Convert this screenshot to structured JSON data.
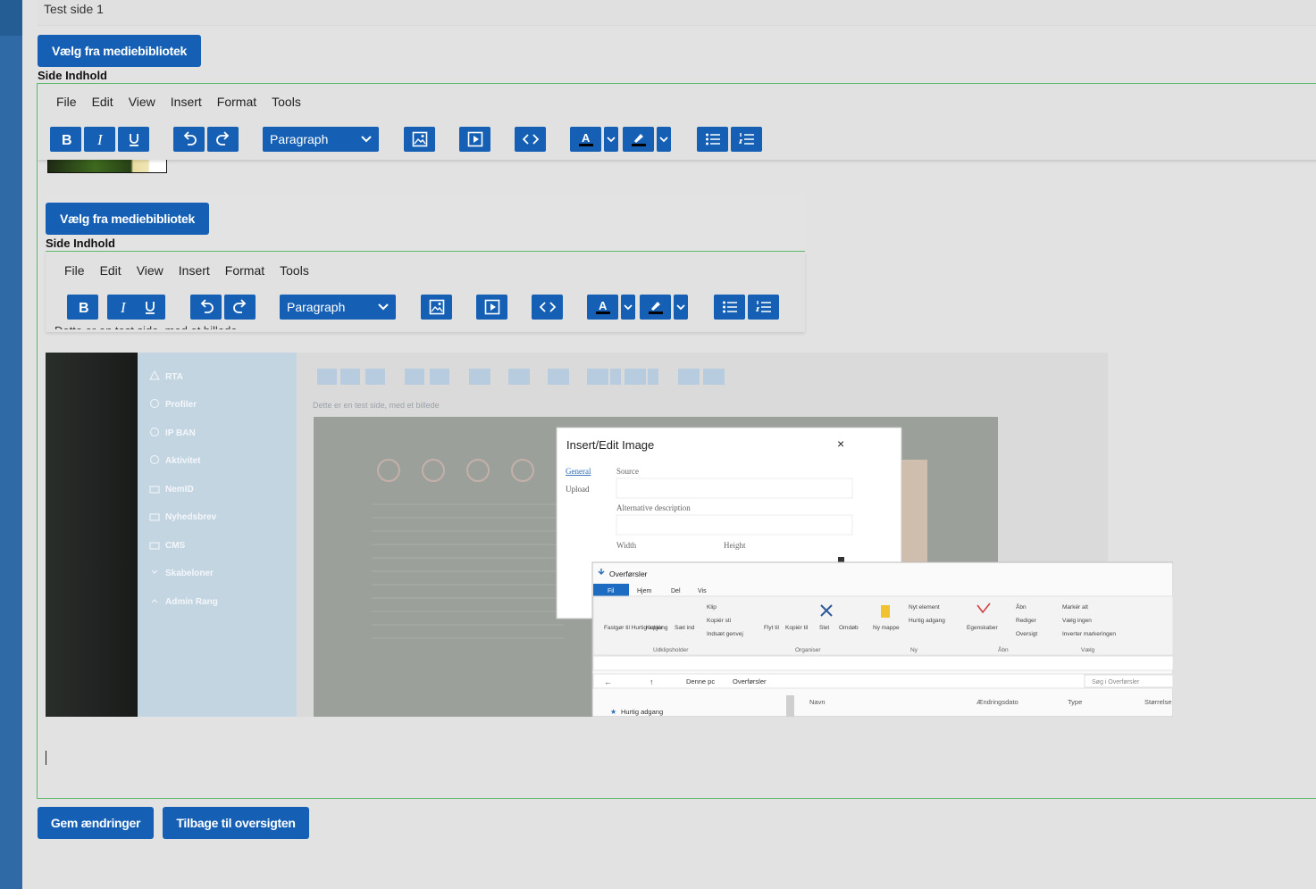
{
  "page": {
    "title_value": "Test side 1",
    "select_media_label": "Vælg fra mediebibliotek",
    "content_label": "Side Indhold",
    "save_label": "Gem ændringer",
    "back_label": "Tilbage til oversigten"
  },
  "editor": {
    "menu": [
      "File",
      "Edit",
      "View",
      "Insert",
      "Format",
      "Tools"
    ],
    "block_format": "Paragraph",
    "icons": {
      "bold": "bold-icon",
      "italic": "italic-icon",
      "underline": "underline-icon",
      "undo": "undo-icon",
      "redo": "redo-icon",
      "image": "image-icon",
      "media": "media-icon",
      "code": "code-icon",
      "text_color": "text-color-icon",
      "highlight": "highlight-icon",
      "bullet_list": "bullet-list-icon",
      "numbered_list": "numbered-list-icon"
    }
  },
  "embedded_content": {
    "partial_text": "Dette er en test side, med et billede",
    "screenshot": {
      "sidebar_items": [
        "RTA",
        "Profiler",
        "IP BAN",
        "Aktivitet",
        "NemID",
        "Nyhedsbrev",
        "CMS",
        "Skabeloner",
        "Admin Rang"
      ],
      "dialog": {
        "title": "Insert/Edit Image",
        "tabs": [
          "General",
          "Upload"
        ],
        "source_label": "Source",
        "alt_label": "Alternative description",
        "width_label": "Width",
        "height_label": "Height"
      },
      "explorer": {
        "title": "Overførsler",
        "tabs": [
          "Fil",
          "Hjem",
          "Del",
          "Vis"
        ],
        "groups": [
          "Udklipsholder",
          "Organiser",
          "Ny",
          "Åbn",
          "Vælg"
        ],
        "ribbon": {
          "pin": "Fastgør til Hurtig adgang",
          "copy": "Kopiér",
          "paste": "Sæt ind",
          "cut": "Klip",
          "copy_path": "Kopiér sti",
          "paste_shortcut": "Indsæt genvej",
          "move_to": "Flyt til",
          "copy_to": "Kopiér til",
          "delete": "Slet",
          "rename": "Omdøb",
          "new_folder": "Ny mappe",
          "new_item": "Nyt element",
          "easy_access": "Hurtig adgang",
          "properties": "Egenskaber",
          "open": "Åbn",
          "edit": "Rediger",
          "history": "Oversigt",
          "select_all": "Markér alt",
          "select_none": "Vælg ingen",
          "invert": "Inverter markeringen"
        },
        "path": [
          "Denne pc",
          "Overførsler"
        ],
        "search_placeholder": "Søg i Overførsler",
        "columns": [
          "Navn",
          "Ændringsdato",
          "Type",
          "Størrelse"
        ],
        "nav_item": "Hurtig adgang"
      }
    }
  },
  "colors": {
    "accent": "#1560b5",
    "sidebar": "#2f6aa6",
    "editor_border": "#5eb86a"
  }
}
